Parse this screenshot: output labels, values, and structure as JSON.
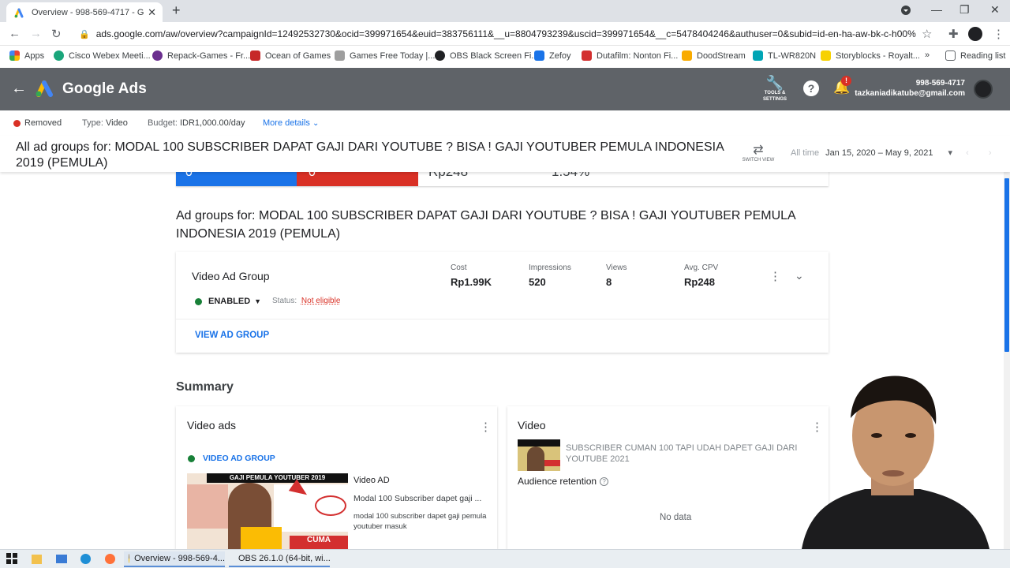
{
  "browser": {
    "tab_title": "Overview - 998-569-4717 - Goo",
    "url": "ads.google.com/aw/overview?campaignId=12492532730&ocid=399971654&euid=383756111&__u=8804793239&uscid=399971654&__c=5478404246&authuser=0&subid=id-en-ha-aw-bk-c-h00%21...",
    "bookmarks": [
      "Apps",
      "Cisco Webex Meeti...",
      "Repack-Games - Fr...",
      "Ocean of Games",
      "Games Free Today |...",
      "OBS Black Screen Fi...",
      "Zefoy",
      "Dutafilm: Nonton Fi...",
      "DoodStream",
      "TL-WR820N",
      "Storyblocks - Royalt..."
    ],
    "reading_list": "Reading list",
    "more": "»"
  },
  "ads_header": {
    "brand": "Google Ads",
    "tools_label": "TOOLS & SETTINGS",
    "notifications_count": "!",
    "account_id": "998-569-4717",
    "account_email": "tazkaniadikatube@gmail.com"
  },
  "campaign_bar": {
    "status": "Removed",
    "type_label": "Type:",
    "type_value": "Video",
    "budget_label": "Budget:",
    "budget_value": "IDR1,000.00/day",
    "more_details": "More details"
  },
  "title_bar": {
    "title": "All ad groups for: MODAL 100 SUBSCRIBER DAPAT GAJI DARI YOUTUBE ? BISA ! GAJI YOUTUBER PEMULA INDONESIA 2019 (PEMULA)",
    "switch_view": "SWITCH VIEW",
    "range_label": "All time",
    "range_value": "Jan 15, 2020 – May 9, 2021"
  },
  "bars": {
    "blue_value": "0",
    "red_value": "0",
    "cost_value": "Rp248",
    "rate_value": "1.54%",
    "colors": {
      "blue": "#1a73e8",
      "red": "#d93025"
    }
  },
  "main": {
    "heading": "Ad groups for: MODAL 100 SUBSCRIBER DAPAT GAJI DARI YOUTUBE ? BISA ! GAJI YOUTUBER PEMULA INDONESIA 2019 (PEMULA)",
    "ad_group": {
      "name": "Video Ad Group",
      "state": "ENABLED",
      "status_label": "Status:",
      "status_value": "Not eligible",
      "metrics": [
        {
          "label": "Cost",
          "value": "Rp1.99K"
        },
        {
          "label": "Impressions",
          "value": "520"
        },
        {
          "label": "Views",
          "value": "8"
        },
        {
          "label": "Avg. CPV",
          "value": "Rp248"
        }
      ],
      "view_link": "VIEW AD GROUP"
    },
    "summary": "Summary",
    "video_ads_card": {
      "title": "Video ads",
      "group_label": "VIDEO AD GROUP",
      "thumb_caption": "GAJI PEMULA YOUTUBER 2019",
      "thumb_badge": "CUMA",
      "ad_type": "Video AD",
      "ad_headline": "Modal 100 Subscriber dapet gaji ...",
      "ad_desc": "modal 100 subscriber dapet gaji pemula youtuber masuk"
    },
    "video_card": {
      "title": "Video",
      "video_title": "SUBSCRIBER CUMAN 100 TAPI UDAH DAPET GAJI DARI YOUTUBE 2021",
      "retention_label": "Audience retention",
      "no_data": "No data"
    }
  },
  "taskbar": {
    "app1": "Overview - 998-569-4...",
    "app2": "OBS 26.1.0 (64-bit, wi..."
  }
}
